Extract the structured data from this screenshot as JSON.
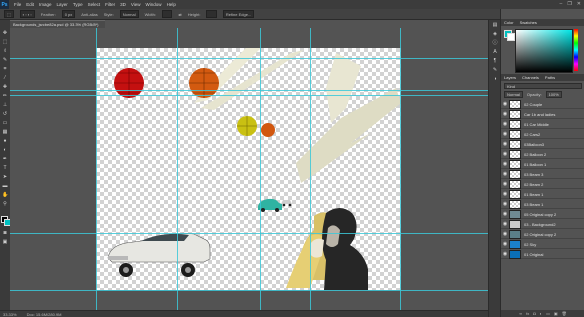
{
  "menubar": {
    "app_icon": "Ps",
    "items": [
      "File",
      "Edit",
      "Image",
      "Layer",
      "Type",
      "Select",
      "Filter",
      "3D",
      "View",
      "Window",
      "Help"
    ],
    "window_controls": [
      "–",
      "❐",
      "✕"
    ]
  },
  "options": {
    "feather_label": "Feather:",
    "feather_value": "0 px",
    "antialias_label": "Anti-alias",
    "style_label": "Style:",
    "style_value": "Normal",
    "width_label": "Width:",
    "height_label": "Height:",
    "refine_label": "Refine Edge..."
  },
  "document": {
    "tab_title": "Backgrounds_jsrcbe82a.psd @ 33.3% (RGB/8*)",
    "zoom": "33.33%",
    "doc_info": "Doc: 15.6M/280.9M"
  },
  "workspace_name": "Essentials",
  "colors": {
    "fg": "#000000",
    "bg": "#00c0c0",
    "panel_fg": "#00c0c0",
    "panel_bg": "#ffffff",
    "guide": "#3cc8d8"
  },
  "panels": {
    "top_tabs": [
      "Color",
      "Swatches"
    ],
    "mid_tabs": [
      "Layers",
      "Channels",
      "Paths"
    ],
    "filter_label": "Kind",
    "blend_mode": "Normal",
    "opacity_label": "Opacity:",
    "opacity_value": "100%",
    "lock_label": "Lock:",
    "fill_label": "Fill:",
    "fill_value": "100%"
  },
  "layers": [
    {
      "name": "02 Couple"
    },
    {
      "name": "Car 1b and ladies"
    },
    {
      "name": "01 Car Middle"
    },
    {
      "name": "02 Cars2"
    },
    {
      "name": "03Balloon3"
    },
    {
      "name": "02 Balloon 2"
    },
    {
      "name": "01 Balloon 1"
    },
    {
      "name": "03 Beam 3"
    },
    {
      "name": "02 Beam 2"
    },
    {
      "name": "01 Beam 1"
    },
    {
      "name": "03 Beam 1"
    },
    {
      "name": "05 Original copy 2"
    },
    {
      "name": "03 - Background2"
    },
    {
      "name": "02 Original copy 2"
    },
    {
      "name": "02 Sky"
    },
    {
      "name": "01 Original"
    }
  ],
  "layers_bottom_icons": [
    "link-icon",
    "fx-icon",
    "mask-icon",
    "adjustment-icon",
    "folder-icon",
    "new-layer-icon",
    "trash-icon"
  ]
}
